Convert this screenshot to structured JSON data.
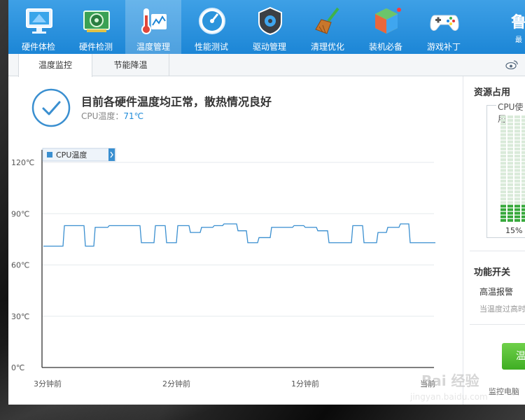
{
  "toolbar": {
    "items": [
      {
        "label": "硬件体检",
        "icon": "monitor-icon"
      },
      {
        "label": "硬件检测",
        "icon": "graphics-card-icon"
      },
      {
        "label": "温度管理",
        "icon": "thermometer-icon",
        "active": true
      },
      {
        "label": "性能测试",
        "icon": "speedometer-icon"
      },
      {
        "label": "驱动管理",
        "icon": "gear-shield-icon"
      },
      {
        "label": "清理优化",
        "icon": "broom-icon"
      },
      {
        "label": "装机必备",
        "icon": "package-cube-icon"
      },
      {
        "label": "游戏补丁",
        "icon": "gamepad-icon"
      }
    ],
    "brand_char": "鲁",
    "brand_sub": "最"
  },
  "subtabs": [
    {
      "label": "温度监控",
      "active": true
    },
    {
      "label": "节能降温",
      "active": false
    }
  ],
  "status": {
    "headline": "目前各硬件温度均正常，散热情况良好",
    "cpu_temp_label": "CPU温度：",
    "cpu_temp_value": "71℃"
  },
  "chart_data": {
    "type": "line",
    "legend": [
      "CPU温度"
    ],
    "ylabel_ticks": [
      "120℃",
      "90℃",
      "60℃",
      "30℃",
      "0℃"
    ],
    "yticks": [
      120,
      90,
      60,
      30,
      0
    ],
    "xlabel_ticks": [
      "3分钟前",
      "2分钟前",
      "1分钟前",
      "当前"
    ],
    "ylim": [
      0,
      120
    ],
    "series": [
      {
        "name": "CPU温度",
        "color": "#3a8fd0",
        "values": [
          71,
          71,
          71,
          71,
          71,
          71,
          71,
          71,
          71,
          71,
          71,
          71,
          71,
          71,
          71,
          71,
          71,
          71,
          71,
          71,
          71,
          71,
          71,
          71,
          71,
          71,
          71,
          71,
          71,
          71,
          71,
          71,
          71,
          71,
          71,
          71,
          71,
          71,
          71,
          71,
          71,
          71,
          71,
          71,
          71,
          71,
          71,
          71,
          71,
          71,
          71,
          71,
          71,
          71,
          71,
          71,
          71,
          71,
          71,
          71,
          71,
          71,
          71,
          71,
          71,
          71,
          71,
          71,
          71,
          71
        ]
      }
    ]
  },
  "resources": {
    "title": "资源占用",
    "cpu_label": "CPU使用",
    "cpu_percent": "15%",
    "cpu_fraction": 0.15
  },
  "features": {
    "title": "功能开关",
    "item_label": "高温报警",
    "item_desc": "当温度过高时"
  },
  "action": {
    "button_label": "温",
    "monitor_text": "监控电脑"
  },
  "watermark": {
    "text": "Bai 经验",
    "url": "jingyan.baidu.com"
  }
}
